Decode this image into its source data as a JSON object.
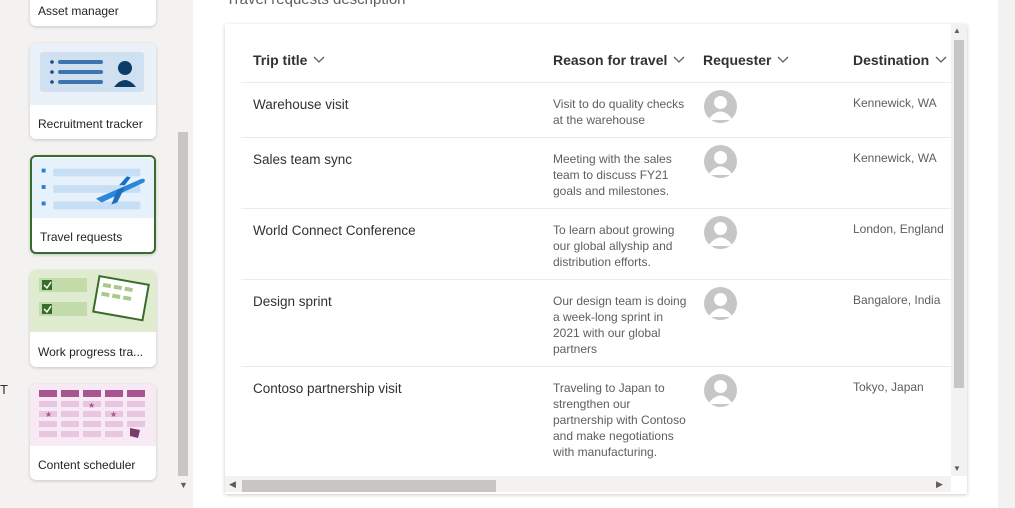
{
  "background": {
    "partial_text": "T"
  },
  "templates": {
    "items": [
      {
        "label": "Asset manager"
      },
      {
        "label": "Recruitment tracker"
      },
      {
        "label": "Travel requests",
        "selected": true
      },
      {
        "label": "Work progress tra..."
      },
      {
        "label": "Content scheduler"
      }
    ]
  },
  "preview": {
    "heading": "Travel requests description",
    "columns": [
      {
        "label": "Trip title",
        "icon": "chevron-down-icon"
      },
      {
        "label": "Reason for travel",
        "icon": "chevron-down-icon"
      },
      {
        "label": "Requester",
        "icon": "chevron-down-icon"
      },
      {
        "label": "Destination",
        "icon": "chevron-down-icon"
      }
    ],
    "rows": [
      {
        "title": "Warehouse visit",
        "reason": "Visit to do quality checks at the warehouse",
        "requester": "person-icon",
        "destination": "Kennewick, WA"
      },
      {
        "title": "Sales team sync",
        "reason": "Meeting with the sales team to discuss FY21 goals and milestones.",
        "requester": "person-icon",
        "destination": "Kennewick, WA"
      },
      {
        "title": "World Connect Conference",
        "reason": "To learn about growing our global allyship and distribution efforts.",
        "requester": "person-icon",
        "destination": "London, England"
      },
      {
        "title": "Design sprint",
        "reason": "Our design team is doing a week-long sprint in 2021 with our global partners",
        "requester": "person-icon",
        "destination": "Bangalore, India"
      },
      {
        "title": "Contoso partnership visit",
        "reason": "Traveling to Japan to strengthen our partnership with Contoso and make negotiations with manufacturing.",
        "requester": "person-icon",
        "destination": "Tokyo, Japan"
      }
    ]
  },
  "colors": {
    "selected_border": "#386c2b",
    "text_primary": "#323130",
    "text_secondary": "#605e5c",
    "scrollbar": "#c8c6c4"
  }
}
